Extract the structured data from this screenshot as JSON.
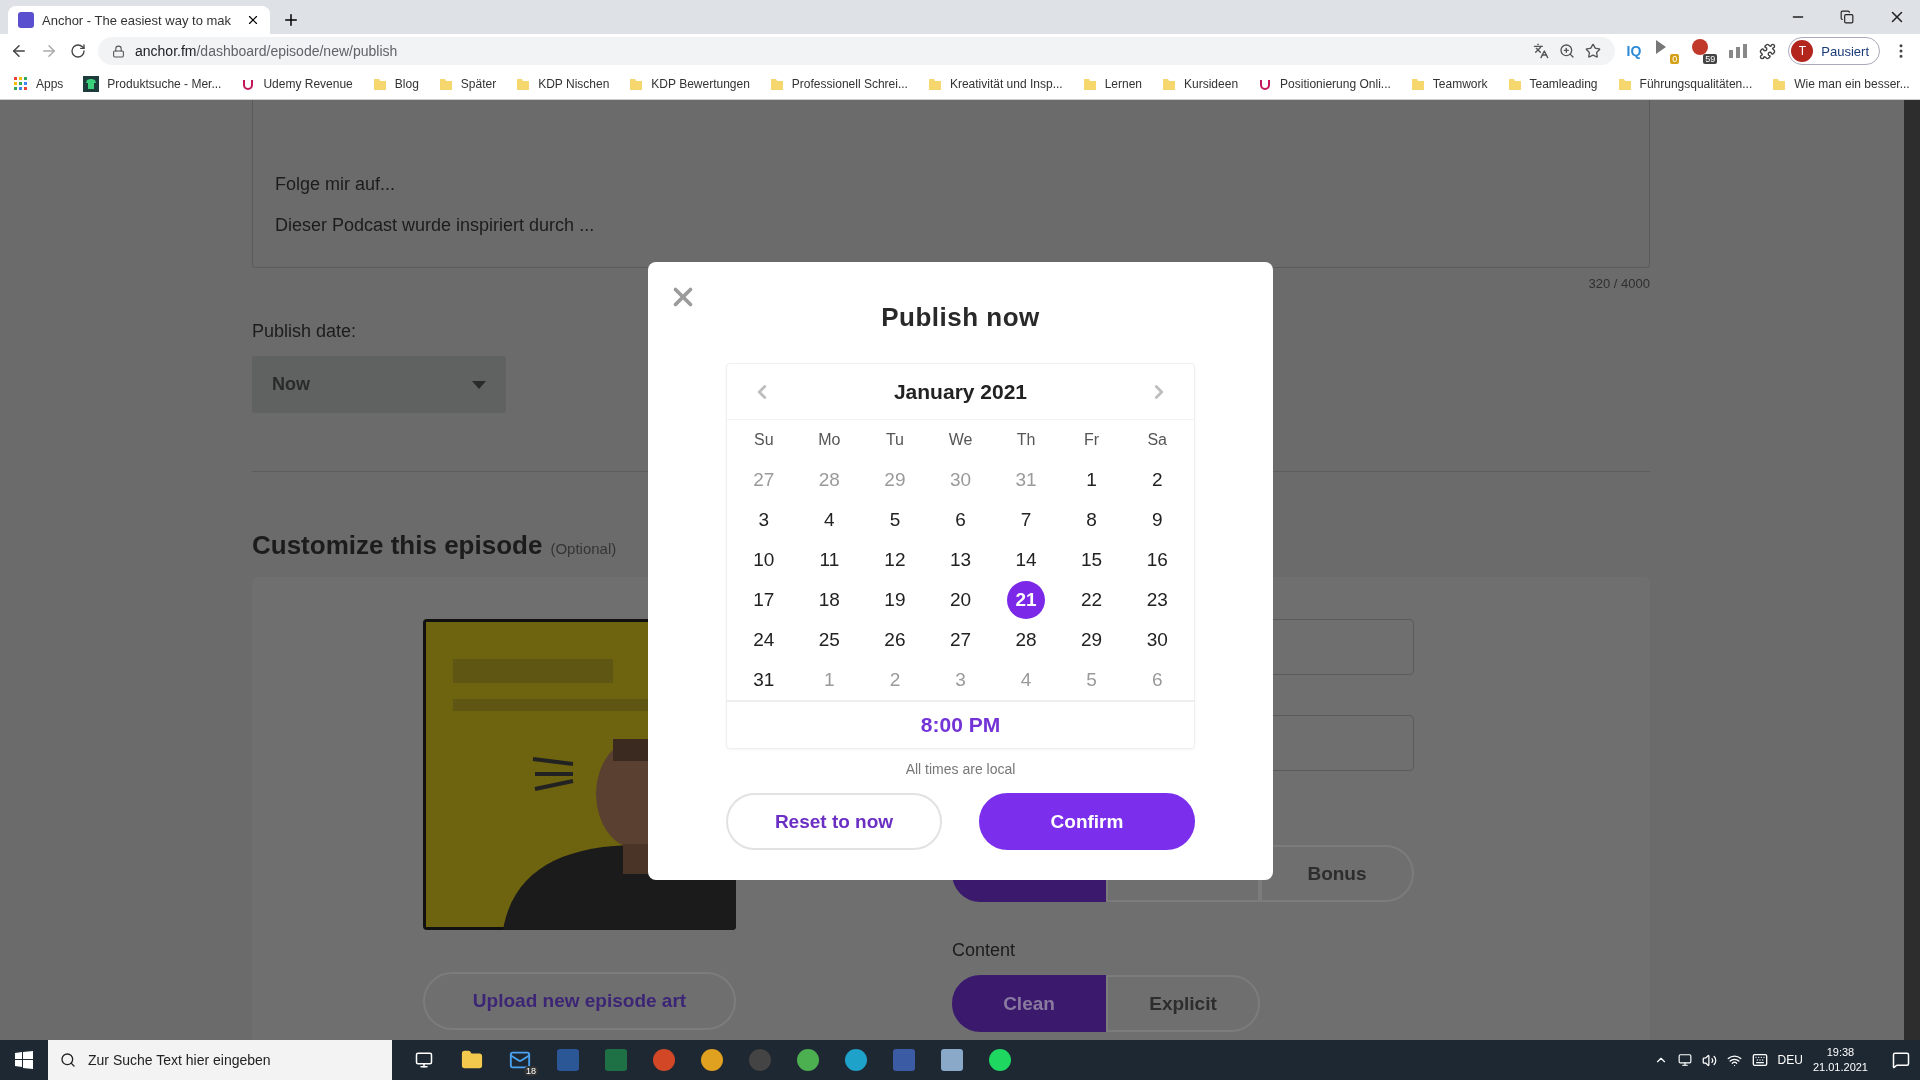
{
  "browser": {
    "tab_title": "Anchor - The easiest way to mak",
    "url_host": "anchor.fm",
    "url_path": "/dashboard/episode/new/publish",
    "extensions": {
      "iq": "IQ",
      "badge_a": "0",
      "badge_b": "59"
    },
    "profile": {
      "initial": "T",
      "label": "Pausiert"
    },
    "bookmarks": [
      {
        "label": "Apps",
        "kind": "apps"
      },
      {
        "label": "Produktsuche - Mer...",
        "kind": "shop"
      },
      {
        "label": "Udemy Revenue",
        "kind": "udemy"
      },
      {
        "label": "Blog",
        "kind": "folder"
      },
      {
        "label": "Später",
        "kind": "folder"
      },
      {
        "label": "KDP Nischen",
        "kind": "folder"
      },
      {
        "label": "KDP Bewertungen",
        "kind": "folder"
      },
      {
        "label": "Professionell Schrei...",
        "kind": "folder"
      },
      {
        "label": "Kreativität und Insp...",
        "kind": "folder"
      },
      {
        "label": "Lernen",
        "kind": "folder"
      },
      {
        "label": "Kursideen",
        "kind": "folder"
      },
      {
        "label": "Positionierung Onli...",
        "kind": "udemy"
      },
      {
        "label": "Teamwork",
        "kind": "folder"
      },
      {
        "label": "Teamleading",
        "kind": "folder"
      },
      {
        "label": "Führungsqualitäten...",
        "kind": "folder"
      },
      {
        "label": "Wie man ein besser...",
        "kind": "folder"
      }
    ]
  },
  "page": {
    "description_lines": [
      "Folge mir auf...",
      "Dieser Podcast wurde inspiriert durch ..."
    ],
    "counter": "320 / 4000",
    "publish_date": {
      "label": "Publish date:",
      "value": "Now"
    },
    "customize": {
      "title": "Customize this episode",
      "hint": "(Optional)"
    },
    "upload_button": "Upload new episode art",
    "episode_type": [
      {
        "selected": true
      },
      {
        "selected": false
      },
      {
        "label": "Bonus",
        "selected": false
      }
    ],
    "content": {
      "label": "Content",
      "options": [
        {
          "label": "Clean",
          "selected": true
        },
        {
          "label": "Explicit",
          "selected": false
        }
      ]
    }
  },
  "modal": {
    "title": "Publish now",
    "month": "January 2021",
    "weekdays": [
      "Su",
      "Mo",
      "Tu",
      "We",
      "Th",
      "Fr",
      "Sa"
    ],
    "days": [
      {
        "label": "27",
        "muted": true,
        "selected": false
      },
      {
        "label": "28",
        "muted": true,
        "selected": false
      },
      {
        "label": "29",
        "muted": true,
        "selected": false
      },
      {
        "label": "30",
        "muted": true,
        "selected": false
      },
      {
        "label": "31",
        "muted": true,
        "selected": false
      },
      {
        "label": "1",
        "muted": false,
        "selected": false
      },
      {
        "label": "2",
        "muted": false,
        "selected": false
      },
      {
        "label": "3",
        "muted": false,
        "selected": false
      },
      {
        "label": "4",
        "muted": false,
        "selected": false
      },
      {
        "label": "5",
        "muted": false,
        "selected": false
      },
      {
        "label": "6",
        "muted": false,
        "selected": false
      },
      {
        "label": "7",
        "muted": false,
        "selected": false
      },
      {
        "label": "8",
        "muted": false,
        "selected": false
      },
      {
        "label": "9",
        "muted": false,
        "selected": false
      },
      {
        "label": "10",
        "muted": false,
        "selected": false
      },
      {
        "label": "11",
        "muted": false,
        "selected": false
      },
      {
        "label": "12",
        "muted": false,
        "selected": false
      },
      {
        "label": "13",
        "muted": false,
        "selected": false
      },
      {
        "label": "14",
        "muted": false,
        "selected": false
      },
      {
        "label": "15",
        "muted": false,
        "selected": false
      },
      {
        "label": "16",
        "muted": false,
        "selected": false
      },
      {
        "label": "17",
        "muted": false,
        "selected": false
      },
      {
        "label": "18",
        "muted": false,
        "selected": false
      },
      {
        "label": "19",
        "muted": false,
        "selected": false
      },
      {
        "label": "20",
        "muted": false,
        "selected": false
      },
      {
        "label": "21",
        "muted": false,
        "selected": true
      },
      {
        "label": "22",
        "muted": false,
        "selected": false
      },
      {
        "label": "23",
        "muted": false,
        "selected": false
      },
      {
        "label": "24",
        "muted": false,
        "selected": false
      },
      {
        "label": "25",
        "muted": false,
        "selected": false
      },
      {
        "label": "26",
        "muted": false,
        "selected": false
      },
      {
        "label": "27",
        "muted": false,
        "selected": false
      },
      {
        "label": "28",
        "muted": false,
        "selected": false
      },
      {
        "label": "29",
        "muted": false,
        "selected": false
      },
      {
        "label": "30",
        "muted": false,
        "selected": false
      },
      {
        "label": "31",
        "muted": false,
        "selected": false
      },
      {
        "label": "1",
        "muted": true,
        "selected": false
      },
      {
        "label": "2",
        "muted": true,
        "selected": false
      },
      {
        "label": "3",
        "muted": true,
        "selected": false
      },
      {
        "label": "4",
        "muted": true,
        "selected": false
      },
      {
        "label": "5",
        "muted": true,
        "selected": false
      },
      {
        "label": "6",
        "muted": true,
        "selected": false
      }
    ],
    "time": "8:00 PM",
    "note": "All times are local",
    "buttons": [
      {
        "label": "Reset to now",
        "kind": "secondary"
      },
      {
        "label": "Confirm",
        "kind": "primary"
      }
    ]
  },
  "taskbar": {
    "search_placeholder": "Zur Suche Text hier eingeben",
    "mail_badge": "18",
    "language": "DEU",
    "time": "19:38",
    "date": "21.01.2021"
  }
}
